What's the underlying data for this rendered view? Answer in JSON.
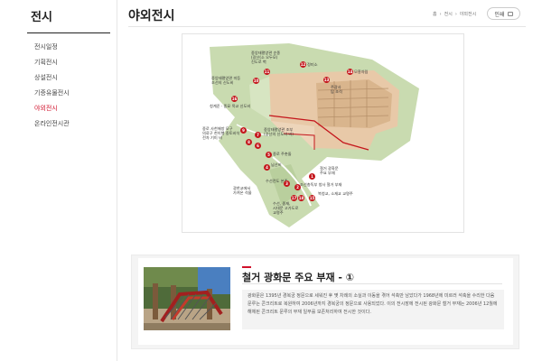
{
  "sidebar": {
    "title": "전시",
    "items": [
      {
        "label": "전시일정",
        "active": false
      },
      {
        "label": "기획전시",
        "active": false
      },
      {
        "label": "상설전시",
        "active": false
      },
      {
        "label": "기증유물전시",
        "active": false
      },
      {
        "label": "야외전시",
        "active": true
      },
      {
        "label": "온라인전시관",
        "active": false
      }
    ]
  },
  "header": {
    "title": "야외전시",
    "breadcrumb": [
      "홈",
      "›",
      "전시",
      "›",
      "야외전시"
    ],
    "print_label": "인쇄",
    "print_icon": "printer-icon"
  },
  "map": {
    "labels": [
      "중앙태평양관 순종\n(광산(소 오두모)\n진도로 벽",
      "정미소",
      "모흥차림",
      "중앙태평양관 미등\n조선의 신도비",
      "주광사\n탑 조석",
      "청계준 · 종묘 목교 신도비",
      "중로 사천해방 모구\n의료구 천이행 중토비석\n전차 기미 비",
      "중앙태평양관 조부\n(광산의 신도비 비)",
      "종로 주춧돌",
      "남산비",
      "철거 광화문\n주요 부재",
      "조선총독부 청사 철거 부재",
      "복청교, 소재교 교명주",
      "수선전도 본주",
      "광한교에서\n가져온 석물",
      "수선, 중재,\n시대문 고가도로\n교명주"
    ],
    "pins": [
      "1",
      "2",
      "3",
      "4",
      "5",
      "6",
      "7",
      "8",
      "9",
      "10",
      "11",
      "12",
      "13",
      "14",
      "15",
      "16",
      "17",
      "18"
    ]
  },
  "exhibit": {
    "title": "철거 광화문 주요 부재 - ①",
    "description": "광화문은 1395년 경복궁 정문으로 세워진 후 몇 차례의 소실과 이동을 겪어 석축만 남았다가 1968년에 미르러 석축을 수리한 다음 문루는 콘크리트로 복원하여 2006년까지 경복궁의 정문으로 사용되었다. 이의 전시장에 전시된 광화문 철거 부재는 2006년 12월에 해체된 콘크리트 문루의 부재 일부를 보존처리하여 전시한 것이다."
  },
  "colors": {
    "accent": "#d0112b",
    "pin": "#c4161c",
    "map_green": "#c9dbb0",
    "map_building": "#e8c9a8"
  }
}
